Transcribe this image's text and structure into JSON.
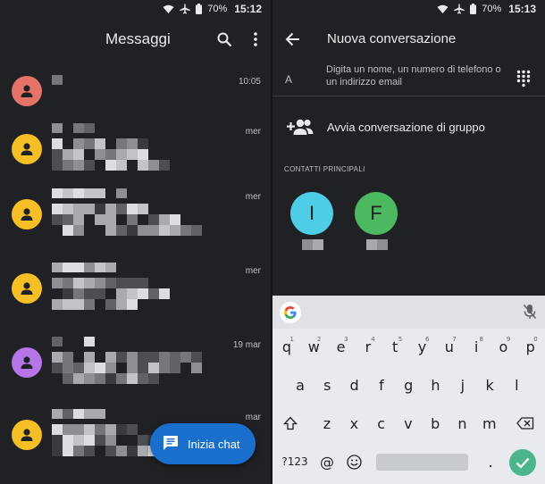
{
  "status_left": {
    "battery": "70%",
    "time": "15:12"
  },
  "status_right": {
    "battery": "70%",
    "time": "15:13"
  },
  "messages_screen": {
    "title": "Messaggi",
    "conversations": [
      {
        "time": "10:05",
        "avatar_color": "#e57368"
      },
      {
        "time": "mer",
        "avatar_color": "#f6bf26"
      },
      {
        "time": "mer",
        "avatar_color": "#f6bf26"
      },
      {
        "time": "mer",
        "avatar_color": "#f6bf26"
      },
      {
        "time": "19 mar",
        "avatar_color": "#b575e8"
      },
      {
        "time": "mar",
        "avatar_color": "#f6bf26"
      }
    ],
    "fab_label": "Inizia chat"
  },
  "new_conversation": {
    "title": "Nuova conversazione",
    "to_label": "A",
    "to_placeholder": "Digita un nome, un numero di telefono o un indirizzo email",
    "group_label": "Avvia conversazione di gruppo",
    "section_label": "CONTATTI PRINCIPALI",
    "contacts": [
      {
        "initial": "I",
        "color": "#4ecde6"
      },
      {
        "initial": "F",
        "color": "#4cb860"
      }
    ]
  },
  "keyboard": {
    "row1": [
      "q",
      "w",
      "e",
      "r",
      "t",
      "y",
      "u",
      "i",
      "o",
      "p"
    ],
    "row1_alt": [
      "1",
      "2",
      "3",
      "4",
      "5",
      "6",
      "7",
      "8",
      "9",
      "0"
    ],
    "row2": [
      "a",
      "s",
      "d",
      "f",
      "g",
      "h",
      "j",
      "k",
      "l"
    ],
    "row3": [
      "z",
      "x",
      "c",
      "v",
      "b",
      "n",
      "m"
    ],
    "symbols_label": "?123",
    "at_label": "@",
    "period_label": ".",
    "enter_color": "#4cb58c"
  }
}
